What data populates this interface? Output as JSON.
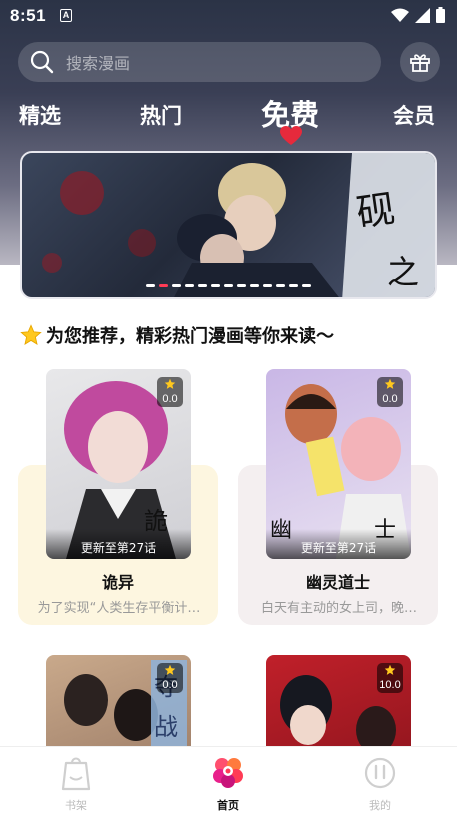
{
  "status": {
    "time": "8:51",
    "badge": "A"
  },
  "search": {
    "placeholder": "搜索漫画"
  },
  "tabs": [
    {
      "label": "精选"
    },
    {
      "label": "热门"
    },
    {
      "label": "免费",
      "active": true
    },
    {
      "label": "会员"
    }
  ],
  "section": {
    "title": "为您推荐，精彩热门漫画等你来读～"
  },
  "cards": [
    {
      "title": "诡异",
      "desc": "为了实现“人类生存平衡计…",
      "rating": "0.0",
      "update": "更新至第27话",
      "bg": "#fdf6e0"
    },
    {
      "title": "幽灵道士",
      "desc": "白天有主动的女上司，晚…",
      "rating": "0.0",
      "update": "更新至第27话",
      "bg": "#f4eff0"
    },
    {
      "title": "",
      "desc": "",
      "rating": "0.0",
      "update": "",
      "bg": "#ffffff"
    },
    {
      "title": "",
      "desc": "",
      "rating": "10.0",
      "update": "",
      "bg": "#ffffff"
    }
  ],
  "nav": [
    {
      "label": "书架"
    },
    {
      "label": "首页",
      "active": true
    },
    {
      "label": "我的"
    }
  ],
  "colors": {
    "accent": "#ff3b55",
    "heart": "#e62a3c"
  }
}
